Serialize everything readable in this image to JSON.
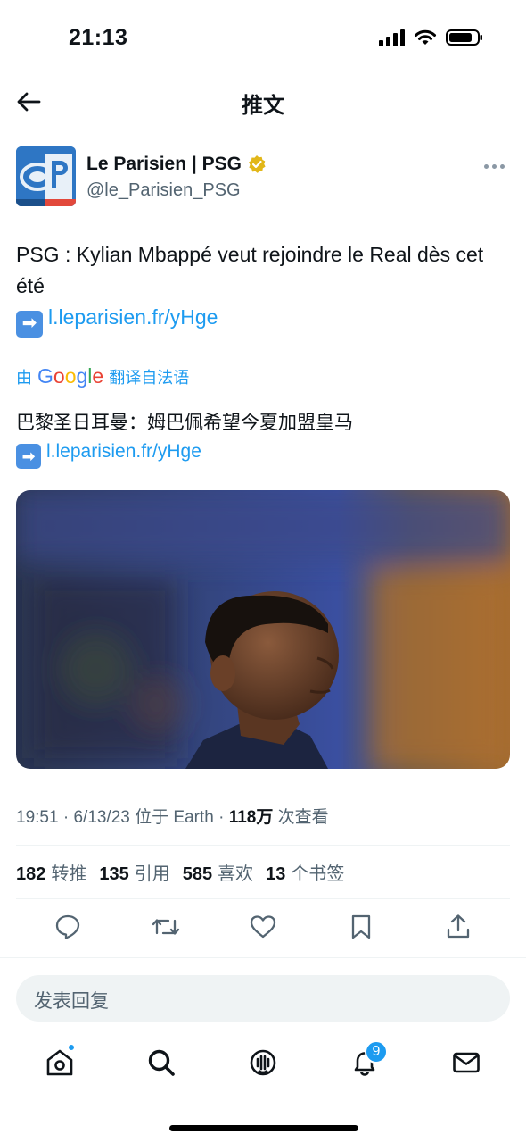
{
  "status_bar": {
    "time": "21:13"
  },
  "nav": {
    "title": "推文"
  },
  "author": {
    "name": "Le Parisien | PSG",
    "handle": "@le_Parisien_PSG",
    "verified_color": "#e2b719"
  },
  "tweet": {
    "text_line": "PSG : Kylian Mbappé veut rejoindre le Real dès cet été",
    "arrow_emoji": "➡",
    "link": "l.leparisien.fr/yHge"
  },
  "translation": {
    "prefix": "由",
    "google": "Google",
    "suffix": "翻译自法语",
    "text": "巴黎圣日耳曼：姆巴佩希望今夏加盟皇马",
    "link": "l.leparisien.fr/yHge"
  },
  "meta": {
    "time": "19:51",
    "date": "6/13/23",
    "location": "位于 Earth",
    "views_count": "118万",
    "views_label": "次查看"
  },
  "stats": [
    {
      "count": "182",
      "label": "转推"
    },
    {
      "count": "135",
      "label": "引用"
    },
    {
      "count": "585",
      "label": "喜欢"
    },
    {
      "count": "13",
      "label": "个书签"
    }
  ],
  "actions": [
    "reply-icon",
    "retweet-icon",
    "like-icon",
    "bookmark-icon",
    "share-icon"
  ],
  "reply": {
    "placeholder": "发表回复"
  },
  "tab_bar": {
    "items": [
      "home-icon",
      "search-icon",
      "spaces-icon",
      "notifications-icon",
      "messages-icon"
    ],
    "notification_badge": "9"
  },
  "colors": {
    "accent": "#1d9bf0",
    "text": "#0f1419",
    "secondary": "#536471"
  }
}
